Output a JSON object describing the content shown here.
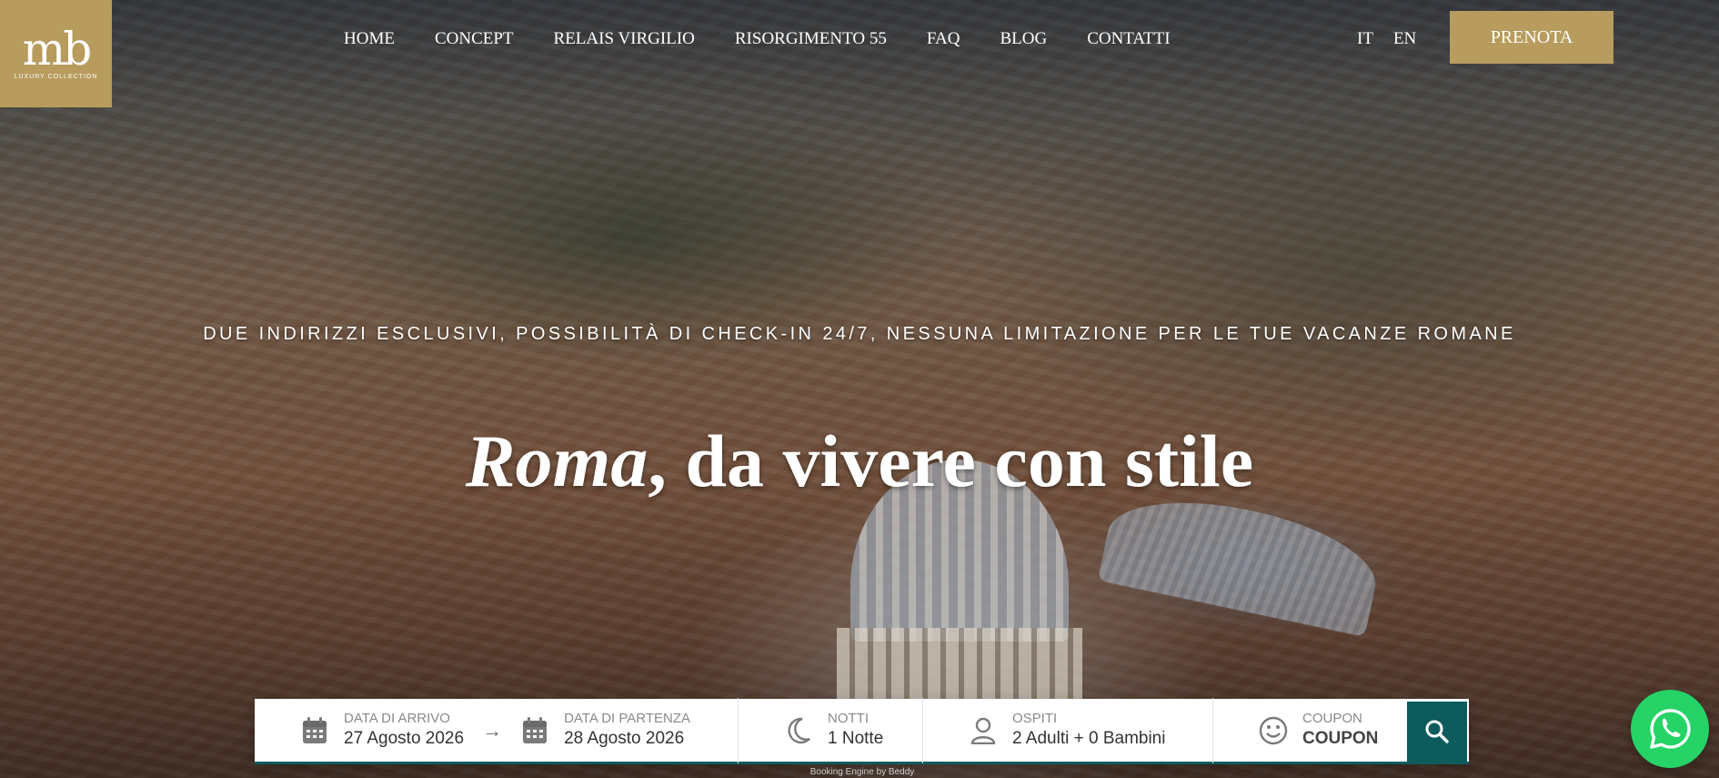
{
  "logo": {
    "mark": "mb",
    "subtitle": "LUXURY COLLECTION",
    "bg_color": "#b79c5e"
  },
  "nav": {
    "items": [
      {
        "label": "HOME"
      },
      {
        "label": "CONCEPT"
      },
      {
        "label": "RELAIS VIRGILIO"
      },
      {
        "label": "RISORGIMENTO 55"
      },
      {
        "label": "FAQ"
      },
      {
        "label": "BLOG"
      },
      {
        "label": "CONTATTI"
      }
    ],
    "languages": [
      "IT",
      "EN"
    ],
    "book_label": "PRENOTA"
  },
  "hero": {
    "tagline": "DUE INDIRIZZI ESCLUSIVI, POSSIBILITÀ DI CHECK-IN 24/7, NESSUNA LIMITAZIONE PER LE TUE VACANZE ROMANE",
    "headline_italic": "Roma",
    "headline_rest": ", da vivere con stile"
  },
  "booking": {
    "arrival": {
      "label": "DATA DI ARRIVO",
      "value": "27 Agosto 2026",
      "icon": "calendar-icon"
    },
    "departure": {
      "label": "DATA DI PARTENZA",
      "value": "28 Agosto 2026",
      "icon": "calendar-icon"
    },
    "nights": {
      "label": "NOTTI",
      "value": "1 Notte",
      "icon": "moon-icon"
    },
    "guests": {
      "label": "OSPITI",
      "value": "2 Adulti + 0 Bambini",
      "icon": "user-icon"
    },
    "coupon": {
      "label": "COUPON",
      "placeholder": "COUPON",
      "icon": "smiley-icon"
    },
    "search_icon": "search-icon",
    "accent_color": "#0e5b5e",
    "powered_by": "Booking Engine by Beddy"
  },
  "whatsapp": {
    "icon": "whatsapp-icon",
    "color": "#25d366"
  }
}
